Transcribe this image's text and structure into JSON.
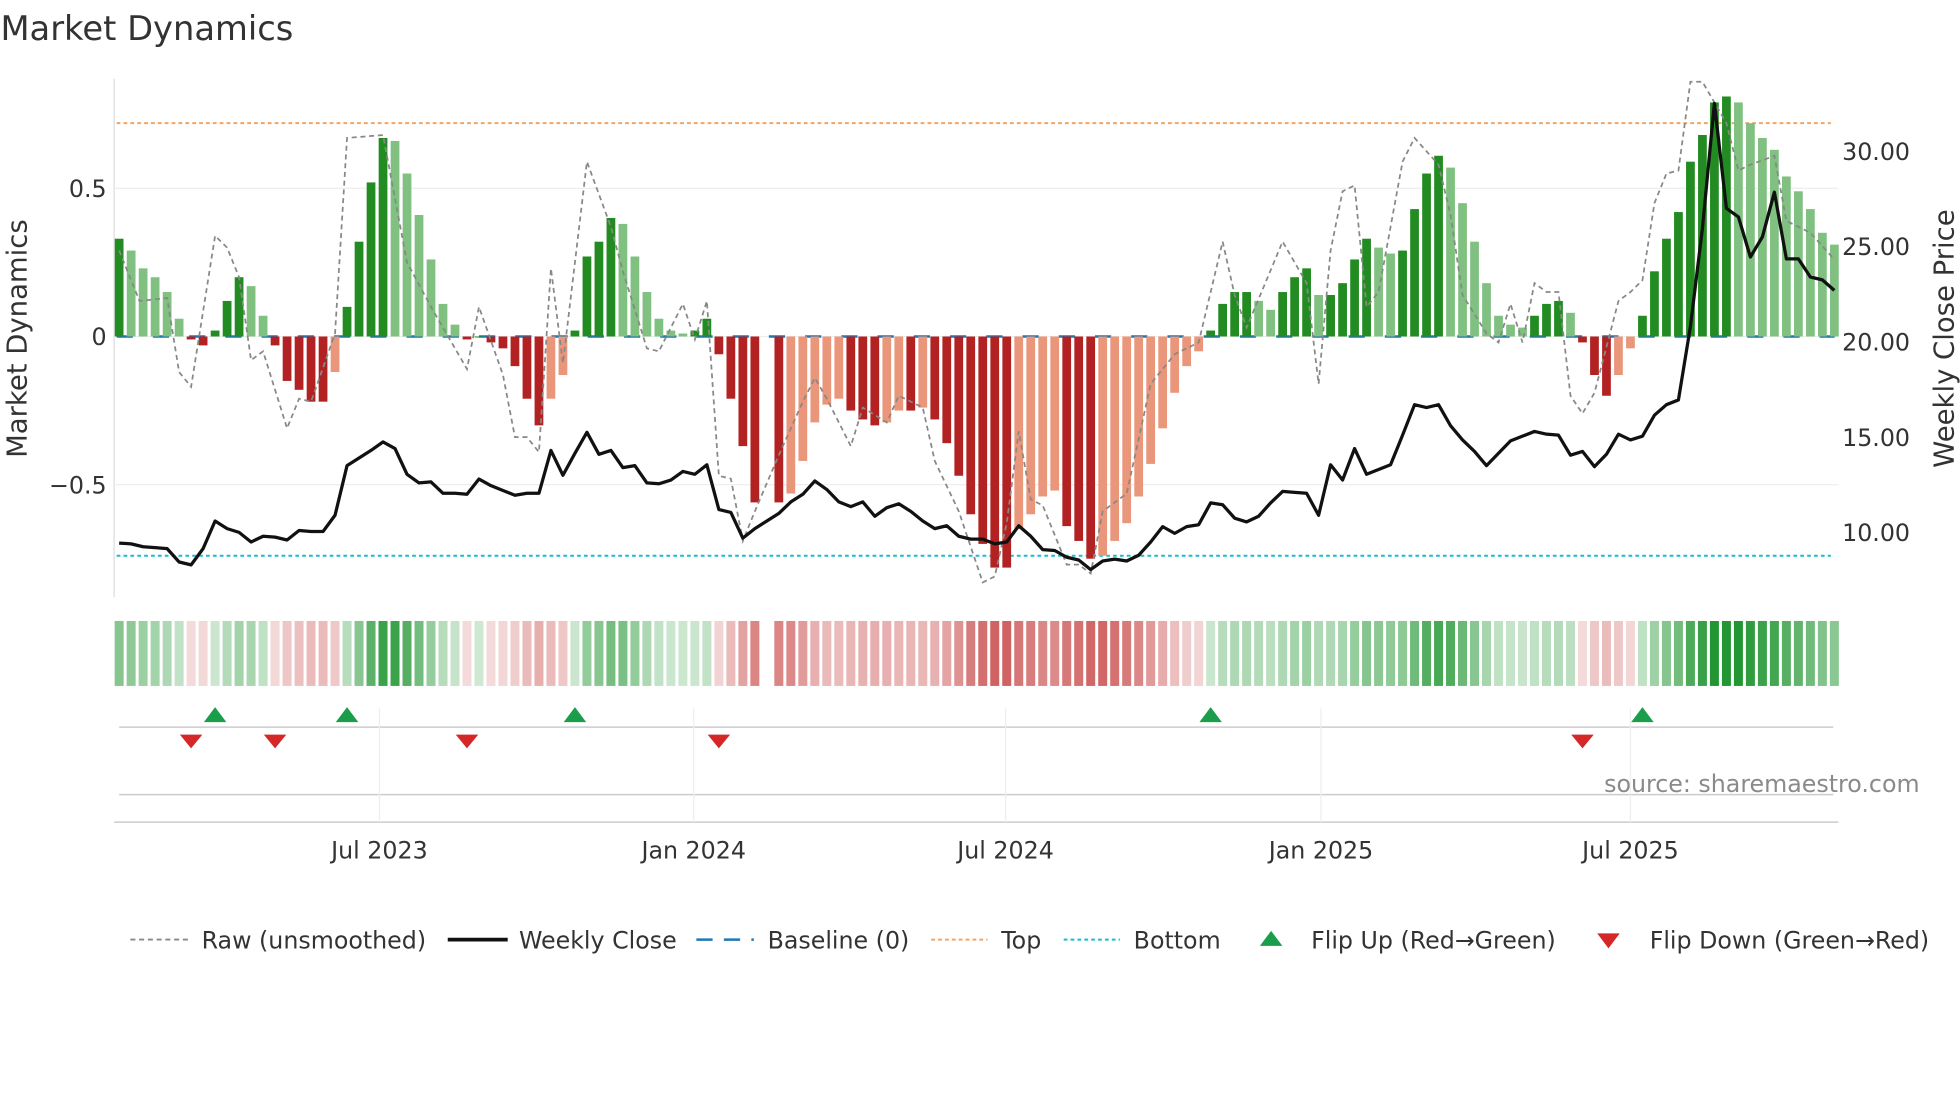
{
  "title": "Market Dynamics",
  "source": "source: sharemaestro.com",
  "colors": {
    "pos_strong": "#228b22",
    "pos_weak": "#80c080",
    "neg_strong": "#b22222",
    "neg_weak": "#e9967a",
    "raw": "#888888",
    "close": "#111111",
    "baseline": "#1f77b4",
    "top": "#f4a261",
    "bottom": "#17becf",
    "flip_up": "#1a9e4a",
    "flip_down": "#d62728"
  },
  "chart_data": {
    "type": "bar+line",
    "title": "Market Dynamics",
    "ylabel": "Market Dynamics",
    "y2label": "Weekly Close Price",
    "ylim": [
      -0.88,
      0.87
    ],
    "y2lim": [
      6.6,
      33.8
    ],
    "yticks": [
      {
        "v": 0.5,
        "label": "0.5"
      },
      {
        "v": 0,
        "label": "0"
      },
      {
        "v": -0.5,
        "label": "−0.5"
      }
    ],
    "y2ticks": [
      {
        "v": 30,
        "label": "30.00"
      },
      {
        "v": 25,
        "label": "25.00"
      },
      {
        "v": 20,
        "label": "20.00"
      },
      {
        "v": 15,
        "label": "15.00"
      },
      {
        "v": 10,
        "label": "10.00"
      }
    ],
    "xticks": [
      {
        "week": 21.7,
        "label": "Jul 2023"
      },
      {
        "week": 47.9,
        "label": "Jan 2024"
      },
      {
        "week": 73.9,
        "label": "Jul 2024"
      },
      {
        "week": 100.2,
        "label": "Jan 2025"
      },
      {
        "week": 126,
        "label": "Jul 2025"
      }
    ],
    "top_level": 0.72,
    "bottom_level": -0.74,
    "baseline": 0,
    "dynamics": [
      0.33,
      0.29,
      0.23,
      0.2,
      0.15,
      0.06,
      -0.01,
      -0.03,
      0.02,
      0.12,
      0.2,
      0.17,
      0.07,
      -0.03,
      -0.15,
      -0.18,
      -0.22,
      -0.22,
      -0.12,
      0.1,
      0.32,
      0.52,
      0.67,
      0.66,
      0.55,
      0.41,
      0.26,
      0.11,
      0.04,
      -0.01,
      0.0,
      -0.02,
      -0.04,
      -0.1,
      -0.21,
      -0.3,
      -0.21,
      -0.13,
      0.02,
      0.27,
      0.32,
      0.4,
      0.38,
      0.27,
      0.15,
      0.06,
      0.02,
      0.01,
      0.02,
      0.06,
      -0.06,
      -0.21,
      -0.37,
      -0.56,
      null,
      -0.56,
      -0.53,
      -0.42,
      -0.29,
      -0.23,
      -0.21,
      -0.25,
      -0.28,
      -0.3,
      -0.29,
      -0.25,
      -0.25,
      -0.24,
      -0.28,
      -0.36,
      -0.47,
      -0.6,
      -0.7,
      -0.78,
      -0.78,
      -0.65,
      -0.6,
      -0.54,
      -0.52,
      -0.64,
      -0.69,
      -0.75,
      -0.74,
      -0.69,
      -0.63,
      -0.54,
      -0.43,
      -0.31,
      -0.19,
      -0.1,
      -0.05,
      0.02,
      0.11,
      0.15,
      0.15,
      0.12,
      0.09,
      0.15,
      0.2,
      0.23,
      0.14,
      0.14,
      0.18,
      0.26,
      0.33,
      0.3,
      0.28,
      0.29,
      0.43,
      0.55,
      0.61,
      0.57,
      0.45,
      0.32,
      0.18,
      0.07,
      0.04,
      0.03,
      0.07,
      0.11,
      0.12,
      0.08,
      -0.02,
      -0.13,
      -0.2,
      -0.13,
      -0.04,
      0.07,
      0.22,
      0.33,
      0.42,
      0.59,
      0.68,
      0.79,
      0.81,
      0.79,
      0.72,
      0.67,
      0.63,
      0.54,
      0.49,
      0.43,
      0.35,
      0.31
    ],
    "weekly_close": [
      9.44,
      9.4,
      9.25,
      9.2,
      9.15,
      8.45,
      8.3,
      9.15,
      10.6,
      10.2,
      10.0,
      9.5,
      9.8,
      9.75,
      9.6,
      10.1,
      10.05,
      10.05,
      10.9,
      13.5,
      13.9,
      14.3,
      14.75,
      14.4,
      13.05,
      12.6,
      12.65,
      12.05,
      12.05,
      12.0,
      12.8,
      12.45,
      12.2,
      11.95,
      12.05,
      12.05,
      14.3,
      13.0,
      14.15,
      15.25,
      14.1,
      14.3,
      13.4,
      13.5,
      12.6,
      12.55,
      12.75,
      13.2,
      13.05,
      13.55,
      11.2,
      11.05,
      9.7,
      10.2,
      10.6,
      11.0,
      11.6,
      12.0,
      12.7,
      12.25,
      11.6,
      11.35,
      11.6,
      10.85,
      11.3,
      11.5,
      11.1,
      10.6,
      10.2,
      10.35,
      9.8,
      9.65,
      9.65,
      9.4,
      9.5,
      10.35,
      9.8,
      9.1,
      9.05,
      8.7,
      8.55,
      8.05,
      8.5,
      8.6,
      8.5,
      8.8,
      9.5,
      10.3,
      9.95,
      10.3,
      10.4,
      11.55,
      11.45,
      10.75,
      10.55,
      10.85,
      11.55,
      12.15,
      12.1,
      12.05,
      10.9,
      13.55,
      12.75,
      14.4,
      13.05,
      13.3,
      13.55,
      15.1,
      16.7,
      16.55,
      16.7,
      15.6,
      14.85,
      14.25,
      13.5,
      14.15,
      14.8,
      15.05,
      15.3,
      15.15,
      15.1,
      14.05,
      14.25,
      13.45,
      14.1,
      15.15,
      14.85,
      15.05,
      16.15,
      16.7,
      16.95,
      20.8,
      25.95,
      32.5,
      27.0,
      26.55,
      24.45,
      25.5,
      27.85,
      24.35,
      24.35,
      23.4,
      23.25,
      22.7
    ],
    "raw_points": [
      [
        0,
        0.29
      ],
      [
        1.7,
        0.12
      ],
      [
        4,
        0.13
      ],
      [
        5,
        -0.12
      ],
      [
        6,
        -0.17
      ],
      [
        8,
        0.34
      ],
      [
        9,
        0.3
      ],
      [
        10,
        0.2
      ],
      [
        11,
        -0.08
      ],
      [
        12,
        -0.05
      ],
      [
        14,
        -0.31
      ],
      [
        15,
        -0.21
      ],
      [
        16,
        -0.22
      ],
      [
        18,
        0.01
      ],
      [
        19,
        0.67
      ],
      [
        22,
        0.68
      ],
      [
        24,
        0.25
      ],
      [
        26,
        0.1
      ],
      [
        29,
        -0.11
      ],
      [
        30,
        0.1
      ],
      [
        32,
        -0.13
      ],
      [
        33,
        -0.34
      ],
      [
        34,
        -0.34
      ],
      [
        35,
        -0.39
      ],
      [
        36,
        0.23
      ],
      [
        37,
        -0.09
      ],
      [
        39,
        0.59
      ],
      [
        41,
        0.37
      ],
      [
        42,
        0.22
      ],
      [
        44,
        -0.04
      ],
      [
        45,
        -0.05
      ],
      [
        47,
        0.11
      ],
      [
        48,
        -0.01
      ],
      [
        49,
        0.12
      ],
      [
        50,
        -0.47
      ],
      [
        51,
        -0.48
      ],
      [
        52,
        -0.69
      ],
      [
        53,
        -0.59
      ],
      [
        55,
        -0.4
      ],
      [
        57,
        -0.22
      ],
      [
        58,
        -0.14
      ],
      [
        59,
        -0.21
      ],
      [
        61,
        -0.37
      ],
      [
        62,
        -0.24
      ],
      [
        64,
        -0.29
      ],
      [
        65,
        -0.2
      ],
      [
        67,
        -0.24
      ],
      [
        68,
        -0.42
      ],
      [
        70,
        -0.59
      ],
      [
        72,
        -0.83
      ],
      [
        73,
        -0.81
      ],
      [
        74,
        -0.63
      ],
      [
        75,
        -0.32
      ],
      [
        76,
        -0.55
      ],
      [
        77,
        -0.57
      ],
      [
        79,
        -0.77
      ],
      [
        80,
        -0.77
      ],
      [
        81,
        -0.8
      ],
      [
        82,
        -0.59
      ],
      [
        84,
        -0.53
      ],
      [
        86,
        -0.16
      ],
      [
        88,
        -0.06
      ],
      [
        90,
        -0.02
      ],
      [
        92,
        0.32
      ],
      [
        93,
        0.14
      ],
      [
        94,
        0.03
      ],
      [
        97,
        0.32
      ],
      [
        99,
        0.18
      ],
      [
        100,
        -0.16
      ],
      [
        101,
        0.29
      ],
      [
        102,
        0.49
      ],
      [
        103,
        0.51
      ],
      [
        104,
        0.1
      ],
      [
        105,
        0.15
      ],
      [
        107,
        0.59
      ],
      [
        108,
        0.67
      ],
      [
        110,
        0.58
      ],
      [
        111,
        0.41
      ],
      [
        112,
        0.14
      ],
      [
        114,
        0.01
      ],
      [
        115,
        -0.02
      ],
      [
        116,
        0.11
      ],
      [
        117,
        -0.02
      ],
      [
        118,
        0.18
      ],
      [
        119,
        0.15
      ],
      [
        120,
        0.15
      ],
      [
        121,
        -0.2
      ],
      [
        122,
        -0.26
      ],
      [
        123,
        -0.19
      ],
      [
        125,
        0.12
      ],
      [
        126,
        0.15
      ],
      [
        127,
        0.19
      ],
      [
        128,
        0.45
      ],
      [
        129,
        0.55
      ],
      [
        130,
        0.56
      ],
      [
        131,
        0.86
      ],
      [
        132,
        0.86
      ],
      [
        134,
        0.72
      ],
      [
        135,
        0.56
      ],
      [
        136,
        0.58
      ],
      [
        138,
        0.61
      ],
      [
        139,
        0.39
      ],
      [
        141,
        0.35
      ],
      [
        143,
        0.26
      ]
    ],
    "flip_up_weeks": [
      8,
      19,
      38,
      91,
      127
    ],
    "flip_down_weeks": [
      6,
      13,
      29,
      50,
      122
    ],
    "legend": [
      {
        "key": "raw",
        "label": "Raw (unsmoothed)"
      },
      {
        "key": "close",
        "label": "Weekly Close"
      },
      {
        "key": "baseline",
        "label": "Baseline (0)"
      },
      {
        "key": "top",
        "label": "Top"
      },
      {
        "key": "bottom",
        "label": "Bottom"
      },
      {
        "key": "flip_up",
        "label": "Flip Up (Red→Green)"
      },
      {
        "key": "flip_down",
        "label": "Flip Down (Green→Red)"
      }
    ],
    "legend_position": "bottom"
  }
}
